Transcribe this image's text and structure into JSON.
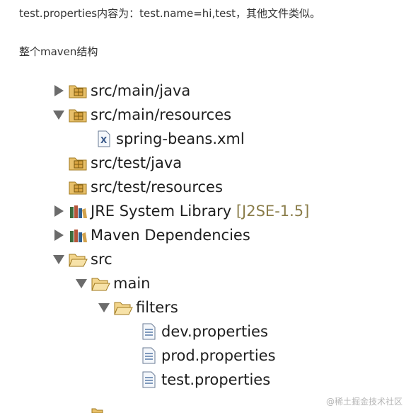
{
  "text": {
    "line1": "test.properties内容为：test.name=hi,test，其他文件类似。",
    "line2": "整个maven结构"
  },
  "tree": [
    {
      "label": "src/main/java",
      "icon": "package-folder-icon",
      "state": "collapsed"
    },
    {
      "label": "src/main/resources",
      "icon": "package-folder-icon",
      "state": "expanded"
    },
    {
      "label": "spring-beans.xml",
      "icon": "xml-file-icon",
      "state": "leaf"
    },
    {
      "label": "src/test/java",
      "icon": "package-folder-icon",
      "state": "leaf"
    },
    {
      "label": "src/test/resources",
      "icon": "package-folder-icon",
      "state": "leaf"
    },
    {
      "label": "JRE System Library",
      "suffix": "[J2SE-1.5]",
      "icon": "library-icon",
      "state": "collapsed"
    },
    {
      "label": "Maven Dependencies",
      "icon": "library-icon",
      "state": "collapsed"
    },
    {
      "label": "src",
      "icon": "open-folder-icon",
      "state": "expanded"
    },
    {
      "label": "main",
      "icon": "open-folder-icon",
      "state": "expanded"
    },
    {
      "label": "filters",
      "icon": "open-folder-icon",
      "state": "expanded"
    },
    {
      "label": "dev.properties",
      "icon": "properties-file-icon",
      "state": "leaf"
    },
    {
      "label": "prod.properties",
      "icon": "properties-file-icon",
      "state": "leaf"
    },
    {
      "label": "test.properties",
      "icon": "properties-file-icon",
      "state": "leaf"
    }
  ],
  "watermark": "@稀土掘金技术社区",
  "colors": {
    "twisty": "#6b6b6b",
    "folder": "#e8c06a",
    "library_suffix": "#8a7d4a"
  }
}
